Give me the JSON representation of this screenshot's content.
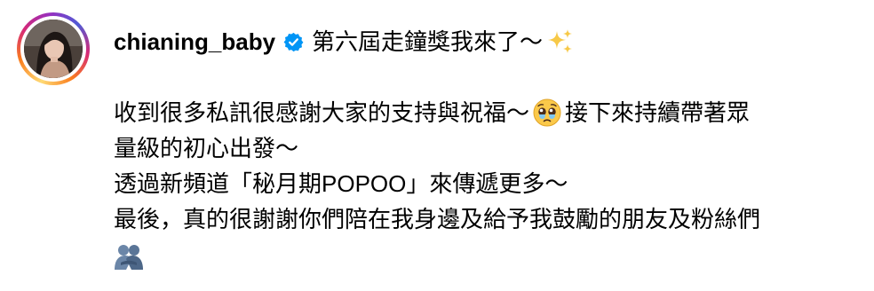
{
  "post": {
    "username": "chianing_baby",
    "verified": true,
    "verified_icon": "verified-badge-icon",
    "avatar": "profile-avatar-image",
    "story_ring_colors": [
      "#feda75",
      "#fa7e1e",
      "#d62976",
      "#962fbf",
      "#4f5bd5"
    ],
    "caption": {
      "title": "第六屆走鐘獎我來了～",
      "title_emoji": "sparkles-icon",
      "line1_a": "收到很多私訊很感謝大家的支持與祝福～",
      "line1_emoji": "pleading-face-tears-icon",
      "line1_b": "接下來持續帶著眾",
      "line2": "量級的初心出發～",
      "line3": "透過新頻道「秘月期POPOO」來傳遞更多～",
      "line4": "最後，真的很謝謝你們陪在我身邊及給予我鼓勵的朋友及粉絲們",
      "line5_emoji": "people-hugging-icon"
    },
    "accent_color": "#0095f6"
  }
}
